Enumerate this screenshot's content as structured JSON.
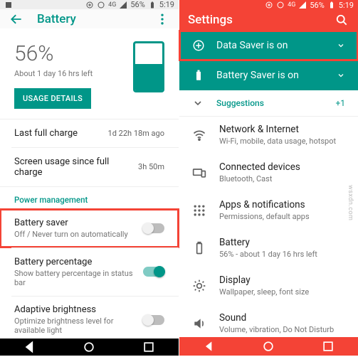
{
  "statusbar": {
    "lte": "4G",
    "battery_pct": "56%",
    "time": "5:19"
  },
  "left": {
    "appbar": {
      "title": "Battery"
    },
    "summary": {
      "percent": "56%",
      "sub": "About 1 day 16 hrs left",
      "usage_btn": "USAGE DETAILS",
      "fill_pct": 56
    },
    "last_charge": {
      "label": "Last full charge",
      "value": "1d 22h 18m ago"
    },
    "screen_usage": {
      "label": "Screen usage since full charge",
      "value": "3h 50m"
    },
    "pm_header": "Power management",
    "battery_saver": {
      "title": "Battery saver",
      "sub": "Off / Never turn on automatically",
      "on": false
    },
    "battery_percentage": {
      "title": "Battery percentage",
      "sub": "Show battery percentage in status bar",
      "on": true
    },
    "adaptive": {
      "title": "Adaptive brightness",
      "sub": "Optimize brightness level for available light",
      "on": false
    }
  },
  "right": {
    "appbar": {
      "title": "Settings"
    },
    "banner": {
      "data_saver": "Data Saver is on",
      "battery_saver": "Battery Saver is on"
    },
    "suggestions": {
      "label": "Suggestions",
      "count": "+1"
    },
    "items": [
      {
        "title": "Network & Internet",
        "sub": "Wi-Fi, mobile, data usage, hotspot",
        "icon": "wifi"
      },
      {
        "title": "Connected devices",
        "sub": "Bluetooth, Cast",
        "icon": "devices"
      },
      {
        "title": "Apps & notifications",
        "sub": "Permissions, default apps",
        "icon": "apps"
      },
      {
        "title": "Battery",
        "sub": "56% - about 1 day 16 hrs left",
        "icon": "battery"
      },
      {
        "title": "Display",
        "sub": "Wallpaper, sleep, font size",
        "icon": "display"
      },
      {
        "title": "Sound",
        "sub": "Volume, vibration, Do Not Disturb",
        "icon": "sound"
      }
    ]
  }
}
